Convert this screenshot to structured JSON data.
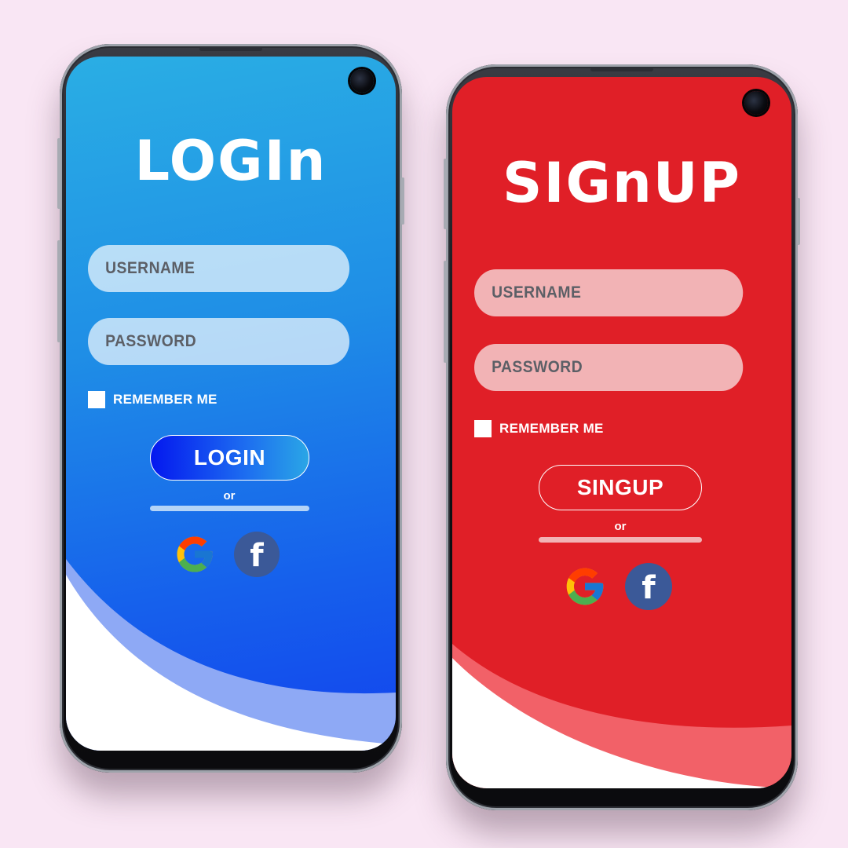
{
  "colors": {
    "background": "#f9e6f4",
    "login_accent": "#1e88e5",
    "signup_accent": "#e01f27",
    "facebook": "#3b5998"
  },
  "login_screen": {
    "title": "LOGIn",
    "username_placeholder": "USERNAME",
    "password_placeholder": "PASSWORD",
    "remember_label": "REMEMBER ME",
    "remember_checked": false,
    "submit_label": "LOGIN",
    "or_label": "or",
    "social": [
      {
        "name": "google",
        "icon": "google-icon"
      },
      {
        "name": "facebook",
        "icon": "facebook-icon",
        "glyph": "f"
      }
    ]
  },
  "signup_screen": {
    "title": "SIGnUP",
    "username_placeholder": "USERNAME",
    "password_placeholder": "PASSWORD",
    "remember_label": "REMEMBER ME",
    "remember_checked": false,
    "submit_label": "SINGUP",
    "or_label": "or",
    "social": [
      {
        "name": "google",
        "icon": "google-icon"
      },
      {
        "name": "facebook",
        "icon": "facebook-icon",
        "glyph": "f"
      }
    ]
  }
}
